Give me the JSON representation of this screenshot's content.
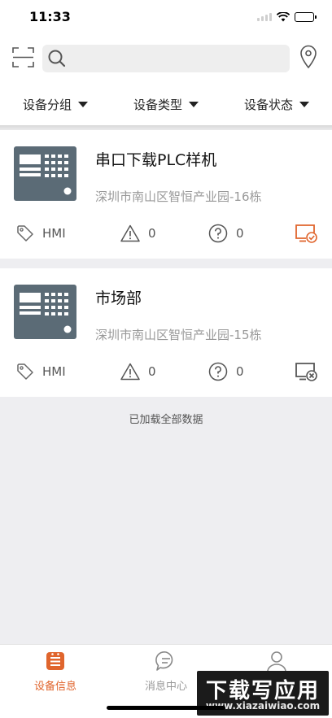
{
  "status_bar": {
    "time": "11:33"
  },
  "search": {
    "placeholder": "",
    "value": ""
  },
  "filters": [
    {
      "label": "设备分组"
    },
    {
      "label": "设备类型"
    },
    {
      "label": "设备状态"
    }
  ],
  "devices": [
    {
      "name": "串口下载PLC样机",
      "address": "深圳市南山区智恒产业园-16栋",
      "type": "HMI",
      "warnings": "0",
      "unknown": "0",
      "connection": "online"
    },
    {
      "name": "市场部",
      "address": "深圳市南山区智恒产业园-15栋",
      "type": "HMI",
      "warnings": "0",
      "unknown": "0",
      "connection": "offline"
    }
  ],
  "list_footer": "已加载全部数据",
  "tabs": [
    {
      "label": "设备信息",
      "icon": "device-list-icon",
      "active": true
    },
    {
      "label": "消息中心",
      "icon": "message-icon",
      "active": false
    },
    {
      "label": "",
      "icon": "user-icon",
      "active": false
    }
  ],
  "watermark": {
    "main": "下载写应用",
    "sub": "www.xiazaiwiao.com"
  },
  "colors": {
    "accent": "#e0652d",
    "device_icon": "#5b6b76",
    "muted_text": "#999999",
    "background": "#eeeef1"
  }
}
